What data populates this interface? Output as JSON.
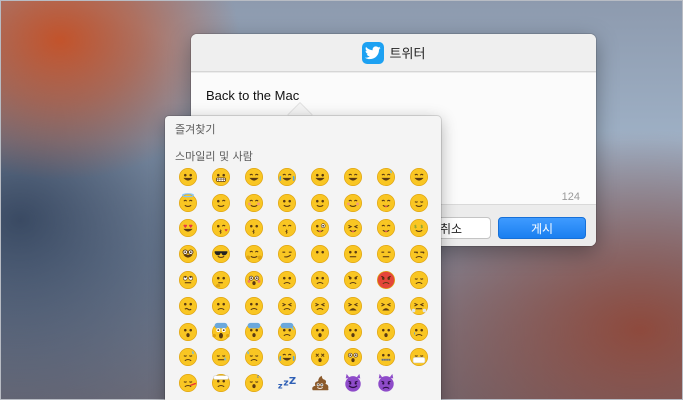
{
  "sheet": {
    "title": "트위터",
    "compose_text": "Back to the Mac",
    "char_count": "124",
    "cancel_label": "취소",
    "post_label": "게시",
    "brand_color": "#1da1f2"
  },
  "picker": {
    "section_favorites": "즐겨찾기",
    "section_smileys": "스마일리 및 사람",
    "emojis": [
      "grinning",
      "grimacing",
      "grin",
      "joy",
      "smiley",
      "smile",
      "sweat-smile",
      "laughing",
      "innocent",
      "wink",
      "blush",
      "slightly-smiling",
      "upside-down",
      "relaxed",
      "yum",
      "relieved",
      "heart-eyes",
      "kissing-heart",
      "kissing",
      "kissing-smiling",
      "stuck-out-tongue-wink",
      "stuck-out-tongue-closed",
      "stuck-out-tongue",
      "money-mouth",
      "nerd",
      "sunglasses",
      "hugging",
      "smirk",
      "no-mouth",
      "neutral",
      "expressionless",
      "unamused",
      "rolling-eyes",
      "thinking",
      "flushed",
      "disappointed",
      "worried",
      "angry",
      "rage",
      "pensive",
      "confused",
      "slightly-frowning",
      "frowning",
      "persevere",
      "confounded",
      "tired",
      "weary",
      "triumph",
      "open-mouth",
      "scream",
      "fearful",
      "cold-sweat",
      "hushed",
      "frowning-open",
      "anguished",
      "cry",
      "disappointed-relieved",
      "sleepy",
      "sweat",
      "sob",
      "dizzy",
      "astonished",
      "zipper",
      "mask",
      "thermometer",
      "head-bandage",
      "sleeping",
      "zzz",
      "poop",
      "smiling-imp",
      "imp"
    ]
  }
}
